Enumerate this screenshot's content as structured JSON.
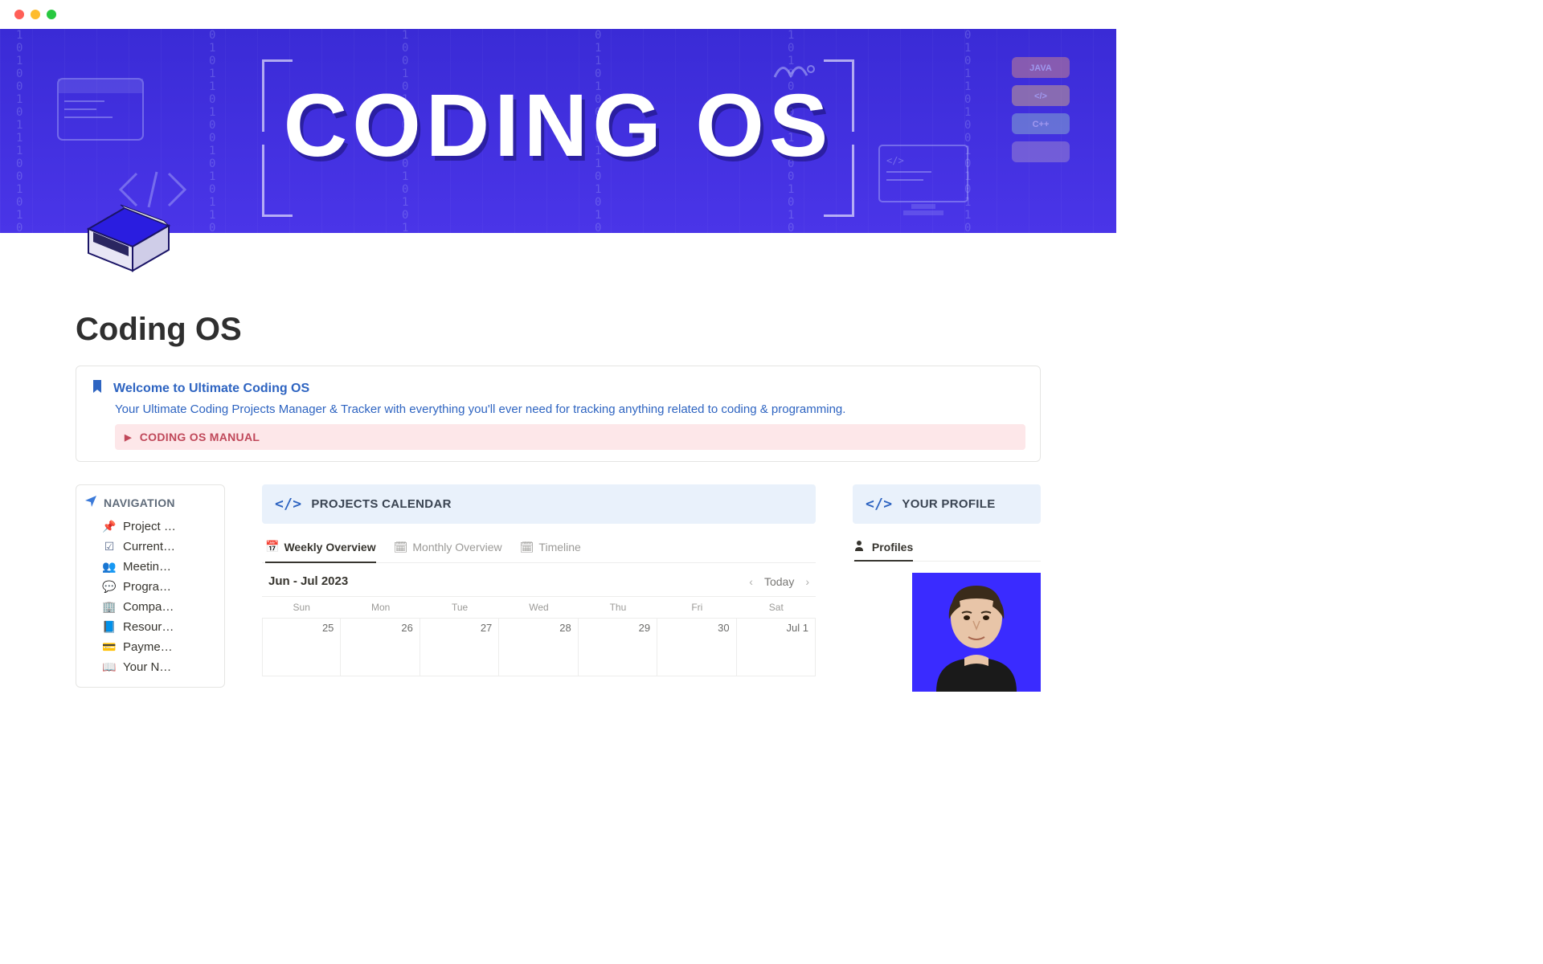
{
  "hero": {
    "title_text": "CODING OS"
  },
  "page": {
    "title": "Coding OS"
  },
  "callout": {
    "heading": "Welcome to Ultimate Coding OS",
    "subtitle": "Your Ultimate Coding Projects Manager & Tracker with everything you'll ever need for tracking anything related to coding & programming.",
    "manual_label": "CODING OS MANUAL"
  },
  "nav": {
    "heading": "NAVIGATION",
    "items": [
      {
        "icon": "pushpin-icon",
        "glyph": "📌",
        "label": "Project …"
      },
      {
        "icon": "checklist-icon",
        "glyph": "☑",
        "label": "Current…"
      },
      {
        "icon": "people-icon",
        "glyph": "👥",
        "label": "Meetin…"
      },
      {
        "icon": "chat-icon",
        "glyph": "💬",
        "label": "Progra…"
      },
      {
        "icon": "building-icon",
        "glyph": "🏢",
        "label": "Compa…"
      },
      {
        "icon": "book-icon",
        "glyph": "📘",
        "label": "Resour…"
      },
      {
        "icon": "card-icon",
        "glyph": "💳",
        "label": "Payme…"
      },
      {
        "icon": "notebook-icon",
        "glyph": "📖",
        "label": "Your N…"
      }
    ]
  },
  "center": {
    "section_title": "PROJECTS CALENDAR",
    "tabs": [
      {
        "icon": "calendar-week-icon",
        "glyph": "📅",
        "label": "Weekly Overview",
        "active": true
      },
      {
        "icon": "calendar-month-icon",
        "glyph": "🗓",
        "label": "Monthly Overview",
        "active": false
      },
      {
        "icon": "timeline-icon",
        "glyph": "🗓",
        "label": "Timeline",
        "active": false
      }
    ],
    "calendar": {
      "range_label": "Jun - Jul 2023",
      "today_label": "Today",
      "dow": [
        "Sun",
        "Mon",
        "Tue",
        "Wed",
        "Thu",
        "Fri",
        "Sat"
      ],
      "days": [
        "25",
        "26",
        "27",
        "28",
        "29",
        "30",
        "Jul 1"
      ]
    }
  },
  "right": {
    "section_title": "YOUR PROFILE",
    "profiles_tab": "Profiles"
  }
}
